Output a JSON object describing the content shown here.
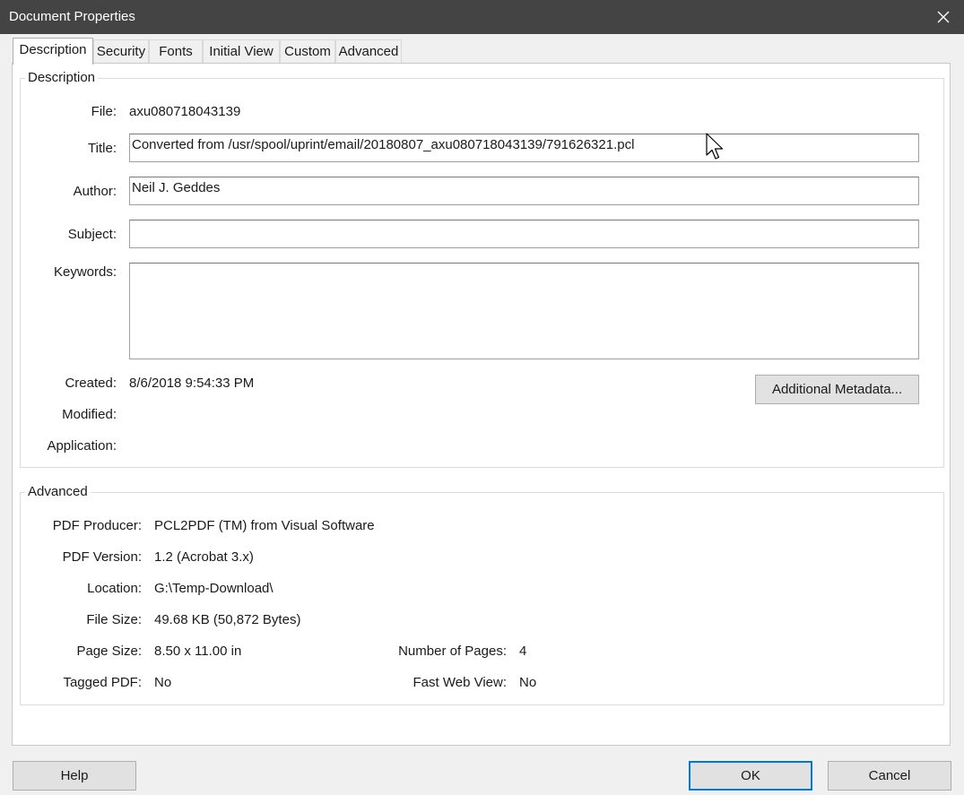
{
  "window": {
    "title": "Document Properties"
  },
  "tabs": [
    {
      "label": "Description"
    },
    {
      "label": "Security"
    },
    {
      "label": "Fonts"
    },
    {
      "label": "Initial View"
    },
    {
      "label": "Custom"
    },
    {
      "label": "Advanced"
    }
  ],
  "description": {
    "group_label": "Description",
    "file_label": "File:",
    "file_value": "axu080718043139",
    "title_label": "Title:",
    "title_value": "Converted from /usr/spool/uprint/email/20180807_axu080718043139/791626321.pcl",
    "author_label": "Author:",
    "author_value": "Neil J. Geddes",
    "subject_label": "Subject:",
    "subject_value": "",
    "keywords_label": "Keywords:",
    "keywords_value": "",
    "created_label": "Created:",
    "created_value": "8/6/2018 9:54:33 PM",
    "modified_label": "Modified:",
    "modified_value": "",
    "application_label": "Application:",
    "application_value": "",
    "metadata_button": "Additional Metadata..."
  },
  "advanced": {
    "group_label": "Advanced",
    "producer_label": "PDF Producer:",
    "producer_value": "PCL2PDF (TM) from Visual Software",
    "version_label": "PDF Version:",
    "version_value": "1.2 (Acrobat 3.x)",
    "location_label": "Location:",
    "location_value": "G:\\Temp-Download\\",
    "filesize_label": "File Size:",
    "filesize_value": "49.68 KB (50,872 Bytes)",
    "pagesize_label": "Page Size:",
    "pagesize_value": "8.50 x 11.00 in",
    "numpages_label": "Number of Pages:",
    "numpages_value": "4",
    "tagged_label": "Tagged PDF:",
    "tagged_value": "No",
    "fastweb_label": "Fast Web View:",
    "fastweb_value": "No"
  },
  "footer": {
    "help_label": "Help",
    "ok_label": "OK",
    "cancel_label": "Cancel"
  },
  "icons": {
    "close": "close-icon",
    "cursor": "mouse-pointer-icon"
  },
  "colors": {
    "titlebar": "#444444",
    "accent": "#0078d7",
    "panel": "#ffffff",
    "dialog": "#f0f0f0"
  }
}
